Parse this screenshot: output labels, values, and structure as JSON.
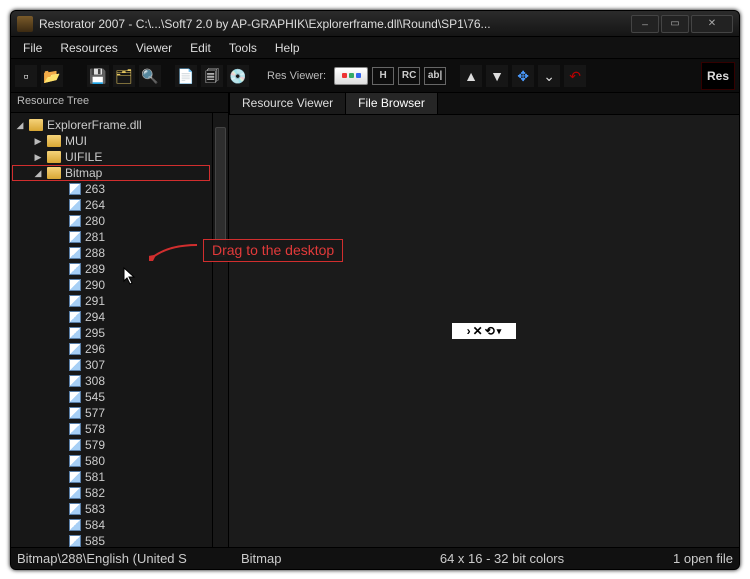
{
  "title": "Restorator 2007 - C:\\...\\Soft7 2.0 by AP-GRAPHIK\\Explorerframe.dll\\Round\\SP1\\76...",
  "menus": [
    "File",
    "Resources",
    "Viewer",
    "Edit",
    "Tools",
    "Help"
  ],
  "toolbar": {
    "res_viewer_label": "Res Viewer:"
  },
  "logo_top": "Res",
  "sidebar_header": "Resource Tree",
  "tree": {
    "root": "ExplorerFrame.dll",
    "folders": [
      "MUI",
      "UIFILE",
      "Bitmap"
    ],
    "bitmaps": [
      "263",
      "264",
      "280",
      "281",
      "288",
      "289",
      "290",
      "291",
      "294",
      "295",
      "296",
      "307",
      "308",
      "545",
      "577",
      "578",
      "579",
      "580",
      "581",
      "582",
      "583",
      "584",
      "585"
    ]
  },
  "tabs": {
    "resource_viewer": "Resource Viewer",
    "file_browser": "File Browser"
  },
  "status": {
    "path": "Bitmap\\288\\English (United S",
    "type": "Bitmap",
    "dims": "64 x 16 - 32 bit colors",
    "open": "1 open file"
  },
  "annotation_text": "Drag to the desktop"
}
